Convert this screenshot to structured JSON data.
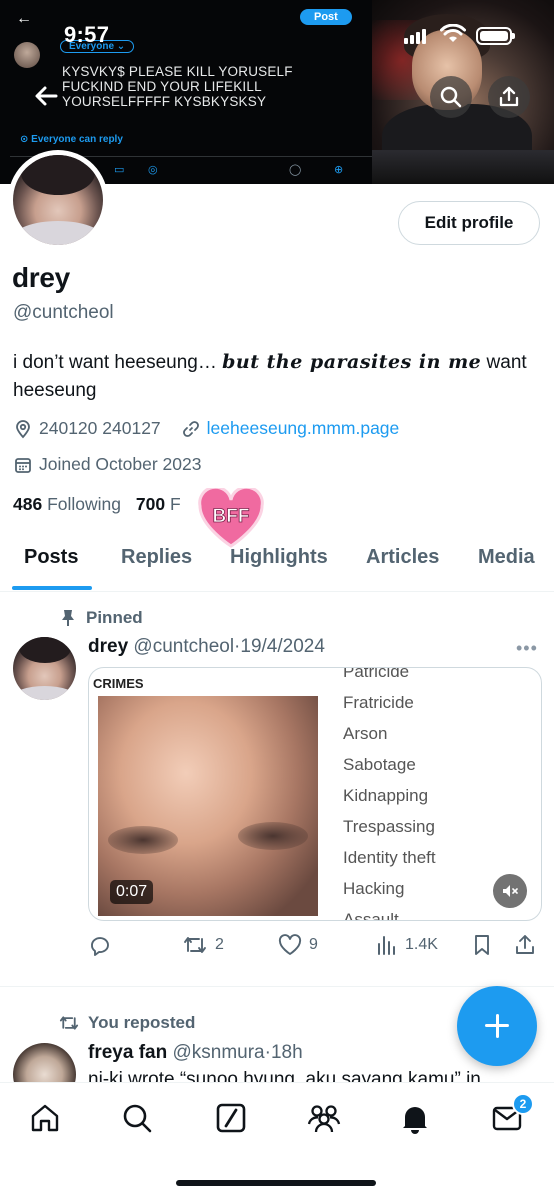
{
  "status_bar": {
    "time": "9:57"
  },
  "banner": {
    "embedded_tweet": {
      "post_button": "Post",
      "audience": "Everyone ⌄",
      "text_lines": [
        "KYSVKY$ PLEASE KILL YORUSELF",
        "FUCKIND END YOUR LIFEKILL",
        "YOURSELFFFFF KYSBKYSKSY"
      ],
      "reply_setting": "Everyone can reply"
    }
  },
  "profile": {
    "display_name": "drey",
    "handle": "@cuntcheol",
    "bio_before": "i don’t want heeseung… ",
    "bio_styled": "but the parasites in me",
    "bio_after": " want heeseung",
    "location": "240120 240127",
    "website": "leeheeseung.mmm.page",
    "joined": "Joined October 2023",
    "following_count": "486",
    "following_label": "Following",
    "followers_count": "700",
    "followers_label_visible": "F",
    "followers_label_tail": "s",
    "edit_profile_label": "Edit profile",
    "sticker_text": "BFF",
    "sticker_color": "#f06aa0"
  },
  "tabs": [
    {
      "label": "Posts",
      "active": true
    },
    {
      "label": "Replies"
    },
    {
      "label": "Highlights"
    },
    {
      "label": "Articles"
    },
    {
      "label": "Media"
    }
  ],
  "pinned_post": {
    "pinned_label": "Pinned",
    "author_name": "drey",
    "author_handle": "@cuntcheol",
    "separator": "·",
    "date": "19/4/2024",
    "media": {
      "label": "CRIMES",
      "duration": "0:07",
      "crimes_list": [
        "Patricide",
        "Fratricide",
        "Arson",
        "Sabotage",
        "Kidnapping",
        "Trespassing",
        "Identity theft",
        "Hacking",
        "Assault"
      ]
    },
    "actions": {
      "replies": "",
      "reposts": "2",
      "likes": "9",
      "views": "1.4K"
    }
  },
  "second_post": {
    "repost_label": "You reposted",
    "author_name": "freya fan",
    "author_handle": "@ksnmura",
    "separator": "·",
    "time": "18h",
    "text": "ni-ki wrote “sunoo hyung, aku sayang kamu” in"
  },
  "nav": {
    "items": [
      "home-icon",
      "search-icon",
      "grok-icon",
      "communities-icon",
      "notifications-icon",
      "messages-icon"
    ],
    "messages_badge": "2"
  },
  "colors": {
    "accent": "#1d9bf0",
    "text": "#0f1419",
    "secondary": "#536471"
  }
}
